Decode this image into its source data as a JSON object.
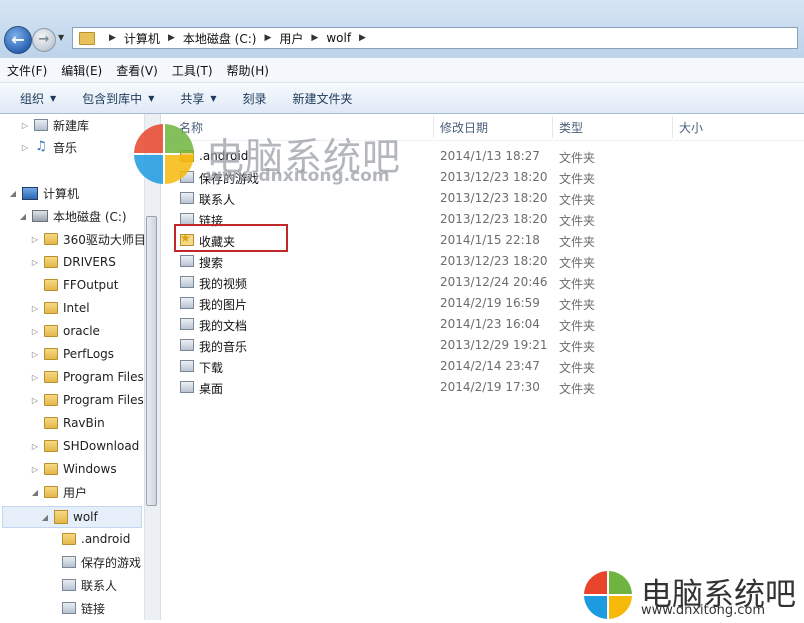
{
  "window": {
    "address": {
      "crumbs": [
        "计算机",
        "本地磁盘 (C:)",
        "用户",
        "wolf"
      ]
    }
  },
  "menu": [
    "文件(F)",
    "编辑(E)",
    "查看(V)",
    "工具(T)",
    "帮助(H)"
  ],
  "toolbar": {
    "organize": "组织",
    "include_library": "包含到库中",
    "share": "共享",
    "burn": "刻录",
    "new_folder": "新建文件夹"
  },
  "tree": [
    {
      "label": "新建库",
      "icon": "library-icon"
    },
    {
      "label": "音乐",
      "icon": "music-icon"
    },
    {
      "label": "计算机",
      "icon": "computer-icon"
    },
    {
      "label": "本地磁盘 (C:)",
      "icon": "drive-icon"
    },
    {
      "label": "360驱动大师目",
      "icon": "folder-icon"
    },
    {
      "label": "DRIVERS",
      "icon": "folder-icon"
    },
    {
      "label": "FFOutput",
      "icon": "folder-icon"
    },
    {
      "label": "Intel",
      "icon": "folder-icon"
    },
    {
      "label": "oracle",
      "icon": "folder-icon"
    },
    {
      "label": "PerfLogs",
      "icon": "folder-icon"
    },
    {
      "label": "Program Files",
      "icon": "folder-icon"
    },
    {
      "label": "Program Files",
      "icon": "folder-icon"
    },
    {
      "label": "RavBin",
      "icon": "folder-icon"
    },
    {
      "label": "SHDownload",
      "icon": "folder-icon"
    },
    {
      "label": "Windows",
      "icon": "folder-icon"
    },
    {
      "label": "用户",
      "icon": "folder-icon"
    },
    {
      "label": "wolf",
      "icon": "user-folder-icon"
    },
    {
      "label": ".android",
      "icon": "folder-icon"
    },
    {
      "label": "保存的游戏",
      "icon": "saved-games-icon"
    },
    {
      "label": "联系人",
      "icon": "contacts-icon"
    },
    {
      "label": "链接",
      "icon": "links-icon"
    }
  ],
  "columns": {
    "name": "名称",
    "date": "修改日期",
    "type": "类型",
    "size": "大小"
  },
  "files": [
    {
      "name": ".android",
      "date": "2014/1/13 18:27",
      "type": "文件夹",
      "icon": "folder-icon"
    },
    {
      "name": "保存的游戏",
      "date": "2013/12/23 18:20",
      "type": "文件夹",
      "icon": "saved-games-icon"
    },
    {
      "name": "联系人",
      "date": "2013/12/23 18:20",
      "type": "文件夹",
      "icon": "contacts-icon"
    },
    {
      "name": "链接",
      "date": "2013/12/23 18:20",
      "type": "文件夹",
      "icon": "links-icon"
    },
    {
      "name": "收藏夹",
      "date": "2014/1/15 22:18",
      "type": "文件夹",
      "icon": "favorites-star-icon"
    },
    {
      "name": "搜索",
      "date": "2013/12/23 18:20",
      "type": "文件夹",
      "icon": "search-folder-icon"
    },
    {
      "name": "我的视频",
      "date": "2013/12/24 20:46",
      "type": "文件夹",
      "icon": "videos-icon"
    },
    {
      "name": "我的图片",
      "date": "2014/2/19 16:59",
      "type": "文件夹",
      "icon": "pictures-icon"
    },
    {
      "name": "我的文档",
      "date": "2014/1/23 16:04",
      "type": "文件夹",
      "icon": "documents-icon"
    },
    {
      "name": "我的音乐",
      "date": "2013/12/29 19:21",
      "type": "文件夹",
      "icon": "music-folder-icon"
    },
    {
      "name": "下载",
      "date": "2014/2/14 23:47",
      "type": "文件夹",
      "icon": "downloads-icon"
    },
    {
      "name": "桌面",
      "date": "2014/2/19 17:30",
      "type": "文件夹",
      "icon": "desktop-icon"
    }
  ],
  "watermark": {
    "title": "电脑系统吧",
    "url": "www.dnxitong.com",
    "colors": [
      "#e8452c",
      "#6fb43f",
      "#1d9be0",
      "#f6b90a"
    ]
  },
  "colors": {
    "highlight": "#c0282c",
    "titlebar": "#c9dbee"
  }
}
